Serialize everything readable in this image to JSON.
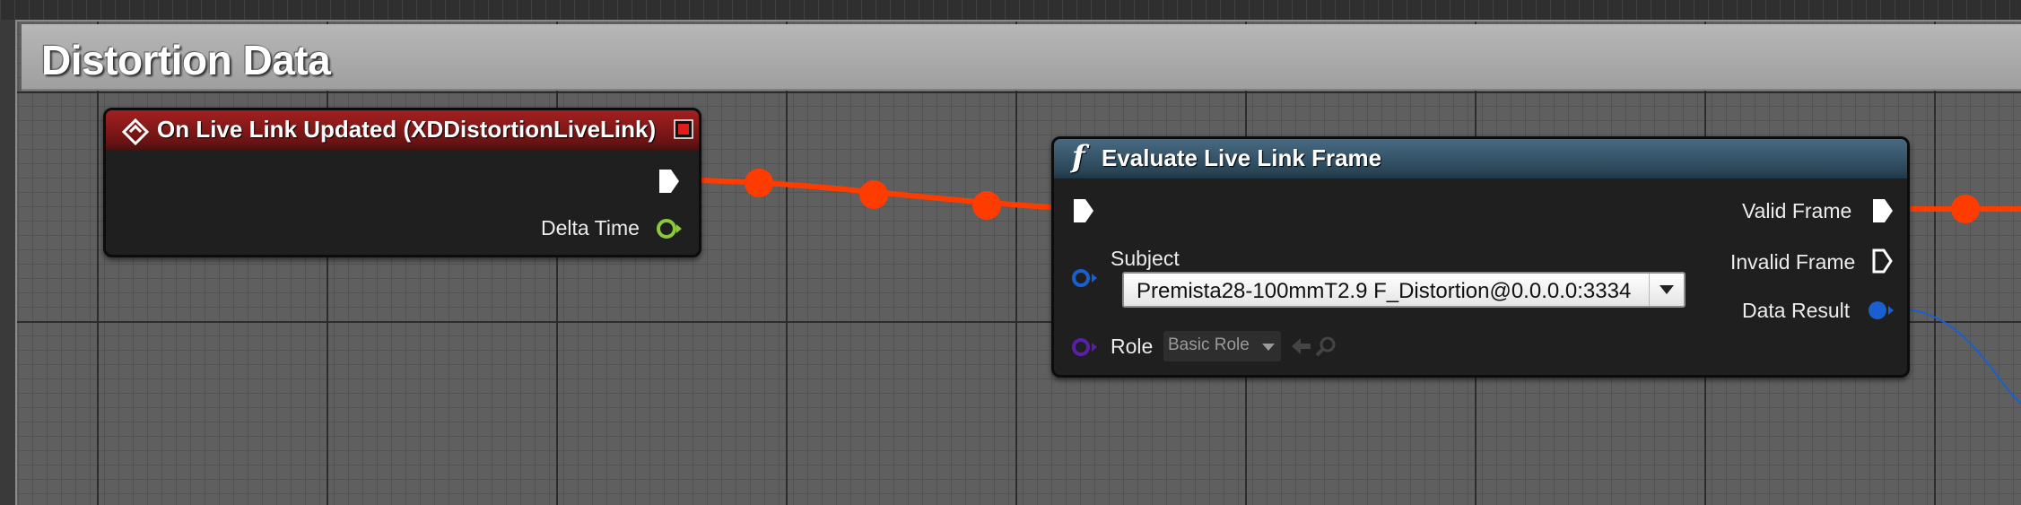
{
  "comment": {
    "title": "Distortion Data"
  },
  "event_node": {
    "title": "On Live Link Updated (XDDistortionLiveLink)",
    "pins": {
      "delta_time": "Delta Time"
    },
    "colors": {
      "header": "#8e1c1c",
      "delta_time_pin": "#8dc63f"
    }
  },
  "function_node": {
    "title": "Evaluate Live Link Frame",
    "function_glyph": "f",
    "inputs": {
      "subject_label": "Subject",
      "subject_value": "Premista28-100mmT2.9 F_Distortion@0.0.0.0:3334",
      "role_label": "Role",
      "role_value": "Basic Role"
    },
    "outputs": {
      "valid_frame": "Valid Frame",
      "invalid_frame": "Invalid Frame",
      "data_result": "Data Result"
    },
    "colors": {
      "header": "#2f4b5e",
      "struct_pin": "#1a5fcf",
      "class_pin": "#5a1fa8"
    }
  },
  "colors": {
    "exec_wire": "#ff3c00",
    "canvas": "#5f5f5f",
    "data_wire": "#1a5fcf"
  },
  "icons": [
    "event-diamond-icon",
    "node-close-icon",
    "function-icon",
    "exec-pin-icon",
    "struct-pin-icon",
    "dropdown-arrow-icon",
    "browse-arrow-icon",
    "search-icon"
  ]
}
